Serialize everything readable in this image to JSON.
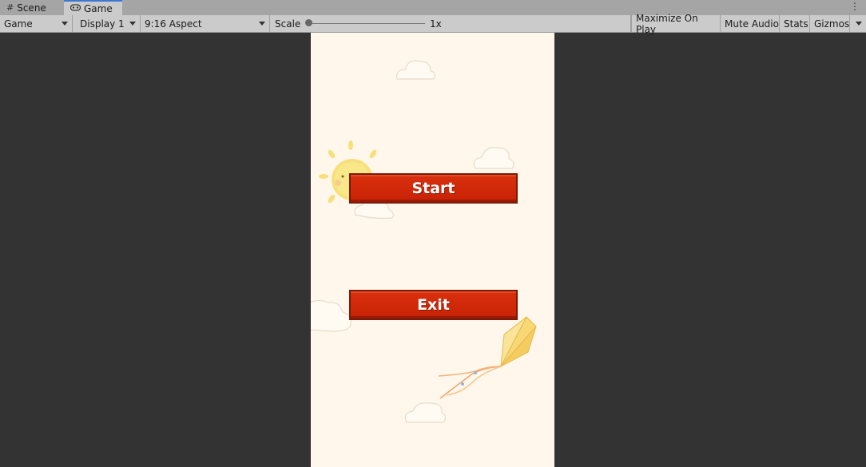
{
  "tabs": {
    "scene": "Scene",
    "game": "Game"
  },
  "toolbar": {
    "view": "Game",
    "display": "Display 1",
    "aspect": "9:16 Aspect",
    "scale_label": "Scale",
    "scale_value": "1x",
    "maximize": "Maximize On Play",
    "mute": "Mute Audio",
    "stats": "Stats",
    "gizmos": "Gizmos"
  },
  "game": {
    "start_label": "Start",
    "exit_label": "Exit"
  }
}
